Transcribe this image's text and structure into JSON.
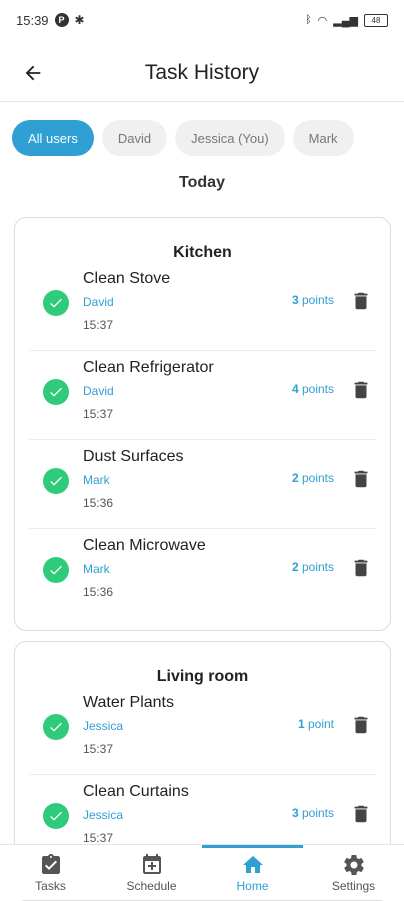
{
  "status": {
    "time": "15:39",
    "battery": "48"
  },
  "header": {
    "title": "Task History",
    "back_icon": "arrow-left-icon"
  },
  "filters": [
    {
      "label": "All users",
      "active": true
    },
    {
      "label": "David",
      "active": false
    },
    {
      "label": "Jessica (You)",
      "active": false
    },
    {
      "label": "Mark",
      "active": false
    }
  ],
  "day_label": "Today",
  "groups": [
    {
      "title": "Kitchen",
      "tasks": [
        {
          "name": "Clean Stove",
          "user": "David",
          "time": "15:37",
          "points_num": "3",
          "points_unit": " points"
        },
        {
          "name": "Clean Refrigerator",
          "user": "David",
          "time": "15:37",
          "points_num": "4",
          "points_unit": " points"
        },
        {
          "name": "Dust Surfaces",
          "user": "Mark",
          "time": "15:36",
          "points_num": "2",
          "points_unit": " points"
        },
        {
          "name": "Clean Microwave",
          "user": "Mark",
          "time": "15:36",
          "points_num": "2",
          "points_unit": " points"
        }
      ]
    },
    {
      "title": "Living room",
      "tasks": [
        {
          "name": "Water Plants",
          "user": "Jessica",
          "time": "15:37",
          "points_num": "1",
          "points_unit": " point"
        },
        {
          "name": "Clean Curtains",
          "user": "Jessica",
          "time": "15:37",
          "points_num": "3",
          "points_unit": " points"
        }
      ]
    }
  ],
  "nav": [
    {
      "label": "Tasks",
      "icon": "clipboard-check-icon",
      "active": false
    },
    {
      "label": "Schedule",
      "icon": "calendar-plus-icon",
      "active": false
    },
    {
      "label": "Home",
      "icon": "home-icon",
      "active": true
    },
    {
      "label": "Settings",
      "icon": "gear-icon",
      "active": false
    }
  ],
  "colors": {
    "accent": "#2f9fd4",
    "check": "#2ecc7a"
  }
}
